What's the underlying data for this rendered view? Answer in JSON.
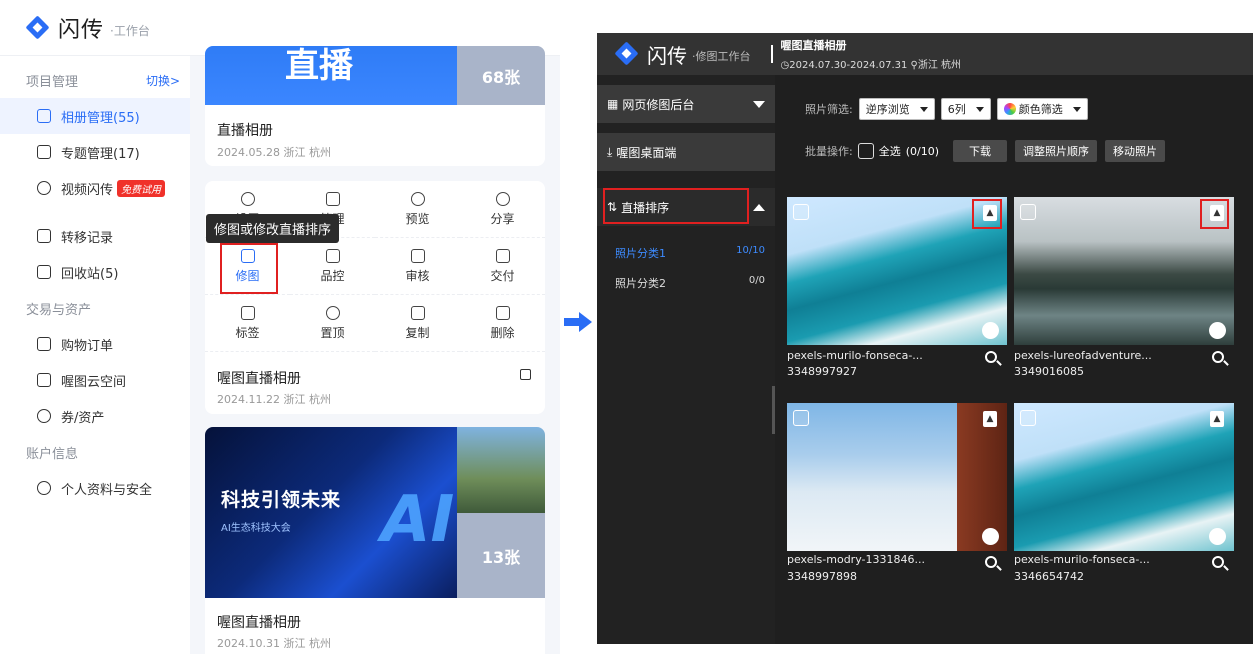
{
  "left_app": {
    "logo_text": "闪传",
    "logo_sub": "·工作台",
    "sidebar": {
      "project_section": "项目管理",
      "switch_label": "切换>",
      "items_project": [
        {
          "label": "相册管理(55)"
        },
        {
          "label": "专题管理(17)"
        },
        {
          "label": "视频闪传",
          "badge": "免费试用"
        },
        {
          "label": "转移记录"
        },
        {
          "label": "回收站(5)"
        }
      ],
      "trade_section": "交易与资产",
      "items_trade": [
        {
          "label": "购物订单"
        },
        {
          "label": "喔图云空间"
        },
        {
          "label": "券/资产"
        }
      ],
      "account_section": "账户信息",
      "items_account": [
        {
          "label": "个人资料与安全"
        }
      ]
    },
    "cards": [
      {
        "banner_text": "直播",
        "count": "68张",
        "title": "直播相册",
        "meta": "2024.05.28 浙江 杭州"
      },
      {
        "title": "喔图直播相册",
        "meta": "2024.11.22 浙江 杭州"
      },
      {
        "banner_text": "科技引领未来",
        "banner_sub": "AI生态科技大会",
        "count": "13张",
        "title": "喔图直播相册",
        "meta": "2024.10.31 浙江 杭州"
      }
    ],
    "ops": [
      {
        "label": "设置"
      },
      {
        "label": "管理"
      },
      {
        "label": "预览"
      },
      {
        "label": "分享"
      },
      {
        "label": "修图"
      },
      {
        "label": "品控"
      },
      {
        "label": "审核"
      },
      {
        "label": "交付"
      },
      {
        "label": "标签"
      },
      {
        "label": "置顶"
      },
      {
        "label": "复制"
      },
      {
        "label": "删除"
      }
    ],
    "tooltip": "修图或修改直播排序"
  },
  "right_app": {
    "logo_text": "闪传",
    "logo_sub": "·修图工作台",
    "album_title": "喔图直播相册",
    "album_meta_date": "2024.07.30-2024.07.31",
    "album_meta_loc": "浙江 杭州",
    "side": {
      "web_backend": "网页修图后台",
      "desktop": "喔图桌面端",
      "live_sort": "直播排序",
      "categories": [
        {
          "name": "照片分类1",
          "count": "10/10"
        },
        {
          "name": "照片分类2",
          "count": "0/0"
        }
      ]
    },
    "toolbar": {
      "filter_label": "照片筛选:",
      "order_value": "逆序浏览",
      "cols_value": "6列",
      "color_filter": "颜色筛选",
      "batch_label": "批量操作:",
      "select_all": "全选",
      "select_count": "(0/10)",
      "download": "下载",
      "adjust_order": "调整照片顺序",
      "move_photo": "移动照片"
    },
    "photos": [
      {
        "name": "pexels-murilo-fonseca-...",
        "id": "3348997927",
        "scene": "wave"
      },
      {
        "name": "pexels-lureofadventure...",
        "id": "3349016085",
        "scene": "lake"
      },
      {
        "name": "pexels-modry-1331846...",
        "id": "3348997898",
        "scene": "birds"
      },
      {
        "name": "pexels-murilo-fonseca-...",
        "id": "3346654742",
        "scene": "wave"
      }
    ]
  },
  "colors": {
    "brand_blue": "#2a6df5",
    "highlight_red": "#e02020",
    "dark_bg": "#1f1f1f",
    "trial_red": "#f0312a"
  }
}
